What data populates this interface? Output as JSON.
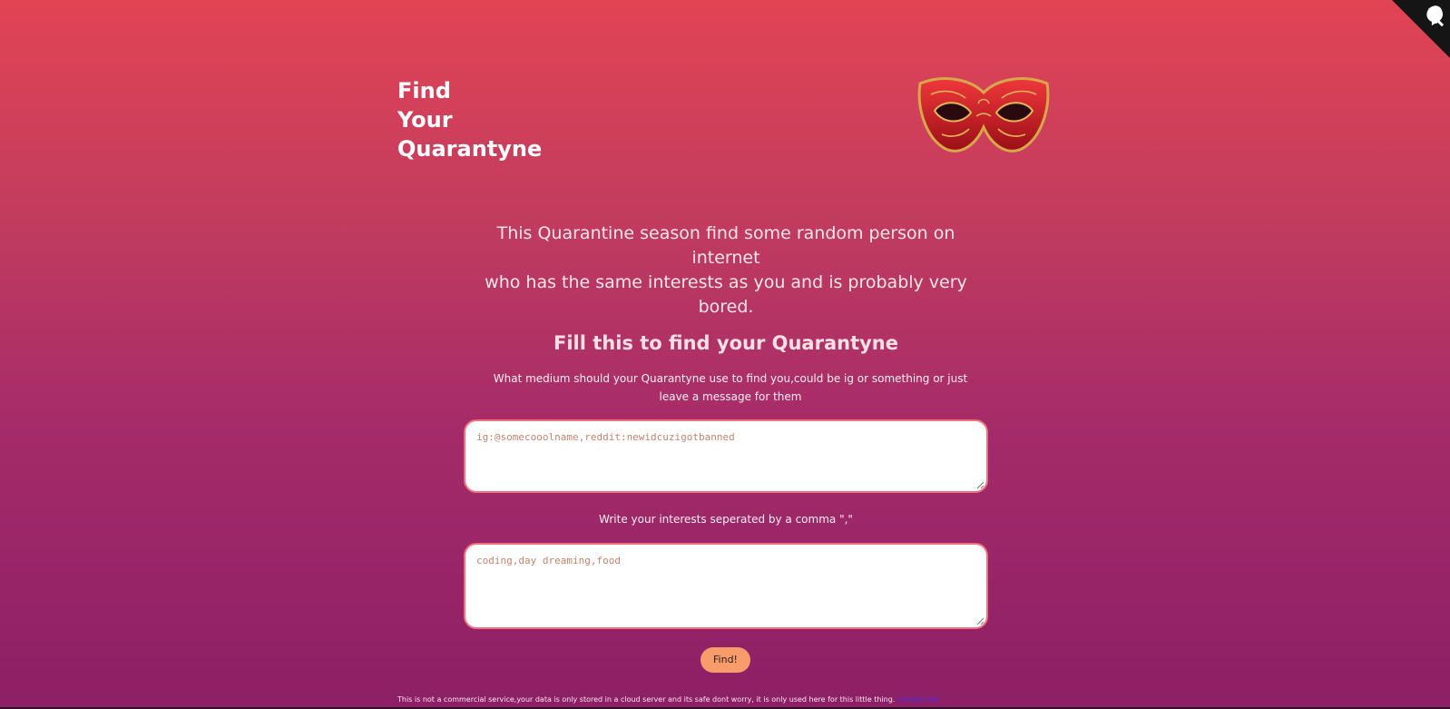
{
  "header": {
    "title_lines": [
      "Find",
      "Your",
      "Quarantyne"
    ],
    "logo": "mask-icon"
  },
  "corner": {
    "icon": "github-octocat-icon",
    "color": "#151515"
  },
  "intro": {
    "line1": "This Quarantine season find some random person on internet",
    "line2": "who has the same interests as you and is probably very bored."
  },
  "form": {
    "title": "Fill this to find your Quarantyne",
    "medium_label": "What medium should your Quarantyne use to find you,could be ig or something or just leave a message for them",
    "medium_value": "ig:@somecooolname,reddit:newidcuzigotbanned",
    "interests_label": "Write your interests seperated by a comma \",\"",
    "interests_value": "coding,day dreaming,food",
    "submit_label": "Find!"
  },
  "footer": {
    "text": "This is not a commercial service,your data is only stored in a cloud server and its safe dont worry, it is only used here for this little thing.",
    "link_label": "contact me"
  },
  "colors": {
    "accent_button": "#f79c6a",
    "field_border": "#f0707c",
    "link": "#4a2df0"
  }
}
